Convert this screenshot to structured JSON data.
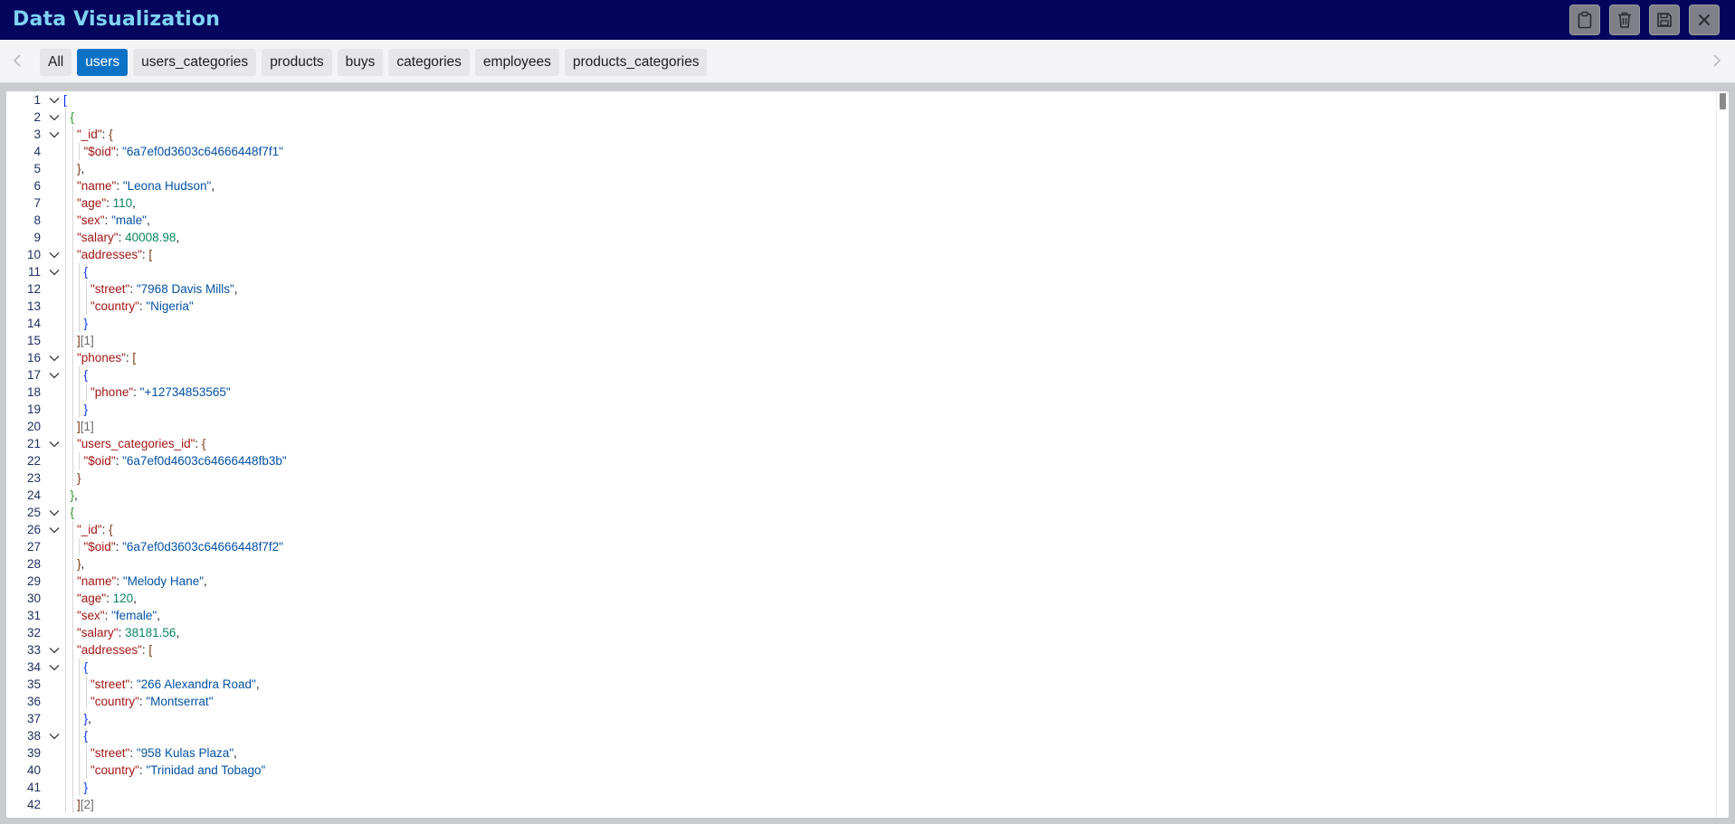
{
  "window": {
    "title": "Data Visualization",
    "toolbar_buttons": [
      {
        "name": "clipboard-button",
        "icon": "clipboard-icon"
      },
      {
        "name": "delete-button",
        "icon": "trash-icon"
      },
      {
        "name": "save-button",
        "icon": "floppy-disk-icon"
      },
      {
        "name": "close-button",
        "icon": "close-icon"
      }
    ]
  },
  "tabs": [
    {
      "label": "All",
      "active": false
    },
    {
      "label": "users",
      "active": true
    },
    {
      "label": "users_categories",
      "active": false
    },
    {
      "label": "products",
      "active": false
    },
    {
      "label": "buys",
      "active": false
    },
    {
      "label": "categories",
      "active": false
    },
    {
      "label": "employees",
      "active": false
    },
    {
      "label": "products_categories",
      "active": false
    }
  ],
  "colors": {
    "titlebar": "#04065e",
    "title_text": "#7fd3f5",
    "active_tab": "#0b72c6",
    "json_key": "#a31515",
    "json_string": "#0451a5",
    "json_number": "#098658"
  },
  "editor": {
    "lines": [
      {
        "n": "1",
        "fold": true,
        "depth": 0,
        "segs": [
          [
            "b1",
            "["
          ]
        ]
      },
      {
        "n": "2",
        "fold": true,
        "depth": 1,
        "segs": [
          [
            "b2",
            "{"
          ]
        ]
      },
      {
        "n": "3",
        "fold": true,
        "depth": 2,
        "segs": [
          [
            "k",
            "\"_id\""
          ],
          [
            "p",
            ": "
          ],
          [
            "b3",
            "{"
          ]
        ]
      },
      {
        "n": "4",
        "fold": false,
        "depth": 3,
        "segs": [
          [
            "k",
            "\"$oid\""
          ],
          [
            "p",
            ": "
          ],
          [
            "s",
            "\"6a7ef0d3603c64666448f7f1\""
          ]
        ]
      },
      {
        "n": "5",
        "fold": false,
        "depth": 2,
        "segs": [
          [
            "b3",
            "}"
          ],
          [
            "p",
            ","
          ]
        ]
      },
      {
        "n": "6",
        "fold": false,
        "depth": 2,
        "segs": [
          [
            "k",
            "\"name\""
          ],
          [
            "p",
            ": "
          ],
          [
            "s",
            "\"Leona Hudson\""
          ],
          [
            "p",
            ","
          ]
        ]
      },
      {
        "n": "7",
        "fold": false,
        "depth": 2,
        "segs": [
          [
            "k",
            "\"age\""
          ],
          [
            "p",
            ": "
          ],
          [
            "n",
            "110"
          ],
          [
            "p",
            ","
          ]
        ]
      },
      {
        "n": "8",
        "fold": false,
        "depth": 2,
        "segs": [
          [
            "k",
            "\"sex\""
          ],
          [
            "p",
            ": "
          ],
          [
            "s",
            "\"male\""
          ],
          [
            "p",
            ","
          ]
        ]
      },
      {
        "n": "9",
        "fold": false,
        "depth": 2,
        "segs": [
          [
            "k",
            "\"salary\""
          ],
          [
            "p",
            ": "
          ],
          [
            "n",
            "40008.98"
          ],
          [
            "p",
            ","
          ]
        ]
      },
      {
        "n": "10",
        "fold": true,
        "depth": 2,
        "segs": [
          [
            "k",
            "\"addresses\""
          ],
          [
            "p",
            ": "
          ],
          [
            "b3",
            "["
          ]
        ]
      },
      {
        "n": "11",
        "fold": true,
        "depth": 3,
        "segs": [
          [
            "b1",
            "{"
          ]
        ]
      },
      {
        "n": "12",
        "fold": false,
        "depth": 4,
        "segs": [
          [
            "k",
            "\"street\""
          ],
          [
            "p",
            ": "
          ],
          [
            "s",
            "\"7968 Davis Mills\""
          ],
          [
            "p",
            ","
          ]
        ]
      },
      {
        "n": "13",
        "fold": false,
        "depth": 4,
        "segs": [
          [
            "k",
            "\"country\""
          ],
          [
            "p",
            ": "
          ],
          [
            "s",
            "\"Nigeria\""
          ]
        ]
      },
      {
        "n": "14",
        "fold": false,
        "depth": 3,
        "segs": [
          [
            "b1",
            "}"
          ]
        ]
      },
      {
        "n": "15",
        "fold": false,
        "depth": 2,
        "segs": [
          [
            "b3",
            "]"
          ],
          [
            "cnt",
            "[1]"
          ]
        ]
      },
      {
        "n": "16",
        "fold": true,
        "depth": 2,
        "segs": [
          [
            "k",
            "\"phones\""
          ],
          [
            "p",
            ": "
          ],
          [
            "b3",
            "["
          ]
        ]
      },
      {
        "n": "17",
        "fold": true,
        "depth": 3,
        "segs": [
          [
            "b1",
            "{"
          ]
        ]
      },
      {
        "n": "18",
        "fold": false,
        "depth": 4,
        "segs": [
          [
            "k",
            "\"phone\""
          ],
          [
            "p",
            ": "
          ],
          [
            "s",
            "\"+12734853565\""
          ]
        ]
      },
      {
        "n": "19",
        "fold": false,
        "depth": 3,
        "segs": [
          [
            "b1",
            "}"
          ]
        ]
      },
      {
        "n": "20",
        "fold": false,
        "depth": 2,
        "segs": [
          [
            "b3",
            "]"
          ],
          [
            "cnt",
            "[1]"
          ]
        ]
      },
      {
        "n": "21",
        "fold": true,
        "depth": 2,
        "segs": [
          [
            "k",
            "\"users_categories_id\""
          ],
          [
            "p",
            ": "
          ],
          [
            "b3",
            "{"
          ]
        ]
      },
      {
        "n": "22",
        "fold": false,
        "depth": 3,
        "segs": [
          [
            "k",
            "\"$oid\""
          ],
          [
            "p",
            ": "
          ],
          [
            "s",
            "\"6a7ef0d4603c64666448fb3b\""
          ]
        ]
      },
      {
        "n": "23",
        "fold": false,
        "depth": 2,
        "segs": [
          [
            "b3",
            "}"
          ]
        ]
      },
      {
        "n": "24",
        "fold": false,
        "depth": 1,
        "segs": [
          [
            "b2",
            "}"
          ],
          [
            "p",
            ","
          ]
        ]
      },
      {
        "n": "25",
        "fold": true,
        "depth": 1,
        "segs": [
          [
            "b2",
            "{"
          ]
        ]
      },
      {
        "n": "26",
        "fold": true,
        "depth": 2,
        "segs": [
          [
            "k",
            "\"_id\""
          ],
          [
            "p",
            ": "
          ],
          [
            "b3",
            "{"
          ]
        ]
      },
      {
        "n": "27",
        "fold": false,
        "depth": 3,
        "segs": [
          [
            "k",
            "\"$oid\""
          ],
          [
            "p",
            ": "
          ],
          [
            "s",
            "\"6a7ef0d3603c64666448f7f2\""
          ]
        ]
      },
      {
        "n": "28",
        "fold": false,
        "depth": 2,
        "segs": [
          [
            "b3",
            "}"
          ],
          [
            "p",
            ","
          ]
        ]
      },
      {
        "n": "29",
        "fold": false,
        "depth": 2,
        "segs": [
          [
            "k",
            "\"name\""
          ],
          [
            "p",
            ": "
          ],
          [
            "s",
            "\"Melody Hane\""
          ],
          [
            "p",
            ","
          ]
        ]
      },
      {
        "n": "30",
        "fold": false,
        "depth": 2,
        "segs": [
          [
            "k",
            "\"age\""
          ],
          [
            "p",
            ": "
          ],
          [
            "n",
            "120"
          ],
          [
            "p",
            ","
          ]
        ]
      },
      {
        "n": "31",
        "fold": false,
        "depth": 2,
        "segs": [
          [
            "k",
            "\"sex\""
          ],
          [
            "p",
            ": "
          ],
          [
            "s",
            "\"female\""
          ],
          [
            "p",
            ","
          ]
        ]
      },
      {
        "n": "32",
        "fold": false,
        "depth": 2,
        "segs": [
          [
            "k",
            "\"salary\""
          ],
          [
            "p",
            ": "
          ],
          [
            "n",
            "38181.56"
          ],
          [
            "p",
            ","
          ]
        ]
      },
      {
        "n": "33",
        "fold": true,
        "depth": 2,
        "segs": [
          [
            "k",
            "\"addresses\""
          ],
          [
            "p",
            ": "
          ],
          [
            "b3",
            "["
          ]
        ]
      },
      {
        "n": "34",
        "fold": true,
        "depth": 3,
        "segs": [
          [
            "b1",
            "{"
          ]
        ]
      },
      {
        "n": "35",
        "fold": false,
        "depth": 4,
        "segs": [
          [
            "k",
            "\"street\""
          ],
          [
            "p",
            ": "
          ],
          [
            "s",
            "\"266 Alexandra Road\""
          ],
          [
            "p",
            ","
          ]
        ]
      },
      {
        "n": "36",
        "fold": false,
        "depth": 4,
        "segs": [
          [
            "k",
            "\"country\""
          ],
          [
            "p",
            ": "
          ],
          [
            "s",
            "\"Montserrat\""
          ]
        ]
      },
      {
        "n": "37",
        "fold": false,
        "depth": 3,
        "segs": [
          [
            "b1",
            "}"
          ],
          [
            "p",
            ","
          ]
        ]
      },
      {
        "n": "38",
        "fold": true,
        "depth": 3,
        "segs": [
          [
            "b1",
            "{"
          ]
        ]
      },
      {
        "n": "39",
        "fold": false,
        "depth": 4,
        "segs": [
          [
            "k",
            "\"street\""
          ],
          [
            "p",
            ": "
          ],
          [
            "s",
            "\"958 Kulas Plaza\""
          ],
          [
            "p",
            ","
          ]
        ]
      },
      {
        "n": "40",
        "fold": false,
        "depth": 4,
        "segs": [
          [
            "k",
            "\"country\""
          ],
          [
            "p",
            ": "
          ],
          [
            "s",
            "\"Trinidad and Tobago\""
          ]
        ]
      },
      {
        "n": "41",
        "fold": false,
        "depth": 3,
        "segs": [
          [
            "b1",
            "}"
          ]
        ]
      },
      {
        "n": "42",
        "fold": false,
        "depth": 2,
        "segs": [
          [
            "b3",
            "]"
          ],
          [
            "cnt",
            "[2]"
          ]
        ]
      }
    ]
  }
}
